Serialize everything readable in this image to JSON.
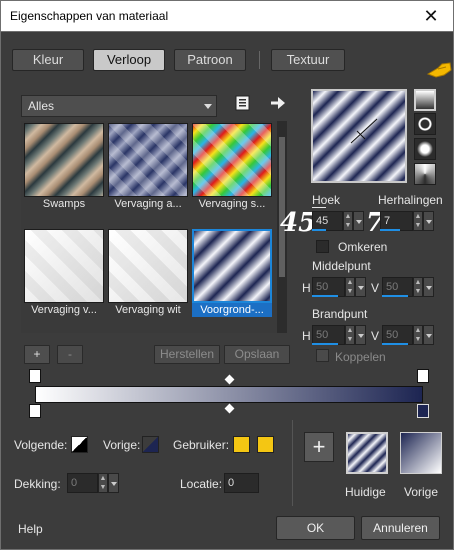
{
  "window": {
    "title": "Eigenschappen van materiaal",
    "close": "✕"
  },
  "tabs": [
    {
      "label": "Kleur",
      "active": false
    },
    {
      "label": "Verloop",
      "active": true
    },
    {
      "label": "Patroon",
      "active": false
    },
    {
      "label": "Textuur",
      "active": false
    }
  ],
  "category": {
    "value": "Alles"
  },
  "gallery": [
    {
      "caption": "Swamps"
    },
    {
      "caption": "Vervaging a..."
    },
    {
      "caption": "Vervaging s..."
    },
    {
      "caption": "Vervaging v..."
    },
    {
      "caption": "Vervaging wit"
    },
    {
      "caption": "Voorgrond-...",
      "selected": true
    }
  ],
  "gallery_buttons": {
    "add": "+",
    "remove": "-",
    "reset": "Herstellen",
    "save": "Opslaan"
  },
  "annotations": {
    "hoek_value": "45",
    "herhalingen_value": "7"
  },
  "properties": {
    "hoek_label": "Hoek",
    "hoek_value": "45",
    "herhalingen_label": "Herhalingen",
    "herhalingen_value": "7",
    "omkeren_label": "Omkeren",
    "omkeren_checked": false,
    "middelpunt_label": "Middelpunt",
    "middelpunt_h": "50",
    "middelpunt_v": "50",
    "brandpunt_label": "Brandpunt",
    "brandpunt_h": "50",
    "brandpunt_v": "50",
    "h_label": "H",
    "v_label": "V",
    "koppelen_label": "Koppelen",
    "koppelen_checked": false
  },
  "gradient_colors": {
    "start": "#ffffff",
    "end": "#1d2552",
    "accent": "#1f8fe5"
  },
  "color_row": {
    "volgende_label": "Volgende:",
    "vorige_label": "Vorige:",
    "gebruiker_label": "Gebruiker:",
    "gebruiker_colors": [
      "#f4c613",
      "#f4c613"
    ]
  },
  "dekking": {
    "label": "Dekking:",
    "value": "0"
  },
  "locatie": {
    "label": "Locatie:",
    "value": "0"
  },
  "preview": {
    "huidige_label": "Huidige",
    "vorige_label": "Vorige",
    "add_symbol": "+"
  },
  "footer": {
    "help": "Help",
    "ok": "OK",
    "cancel": "Annuleren"
  }
}
